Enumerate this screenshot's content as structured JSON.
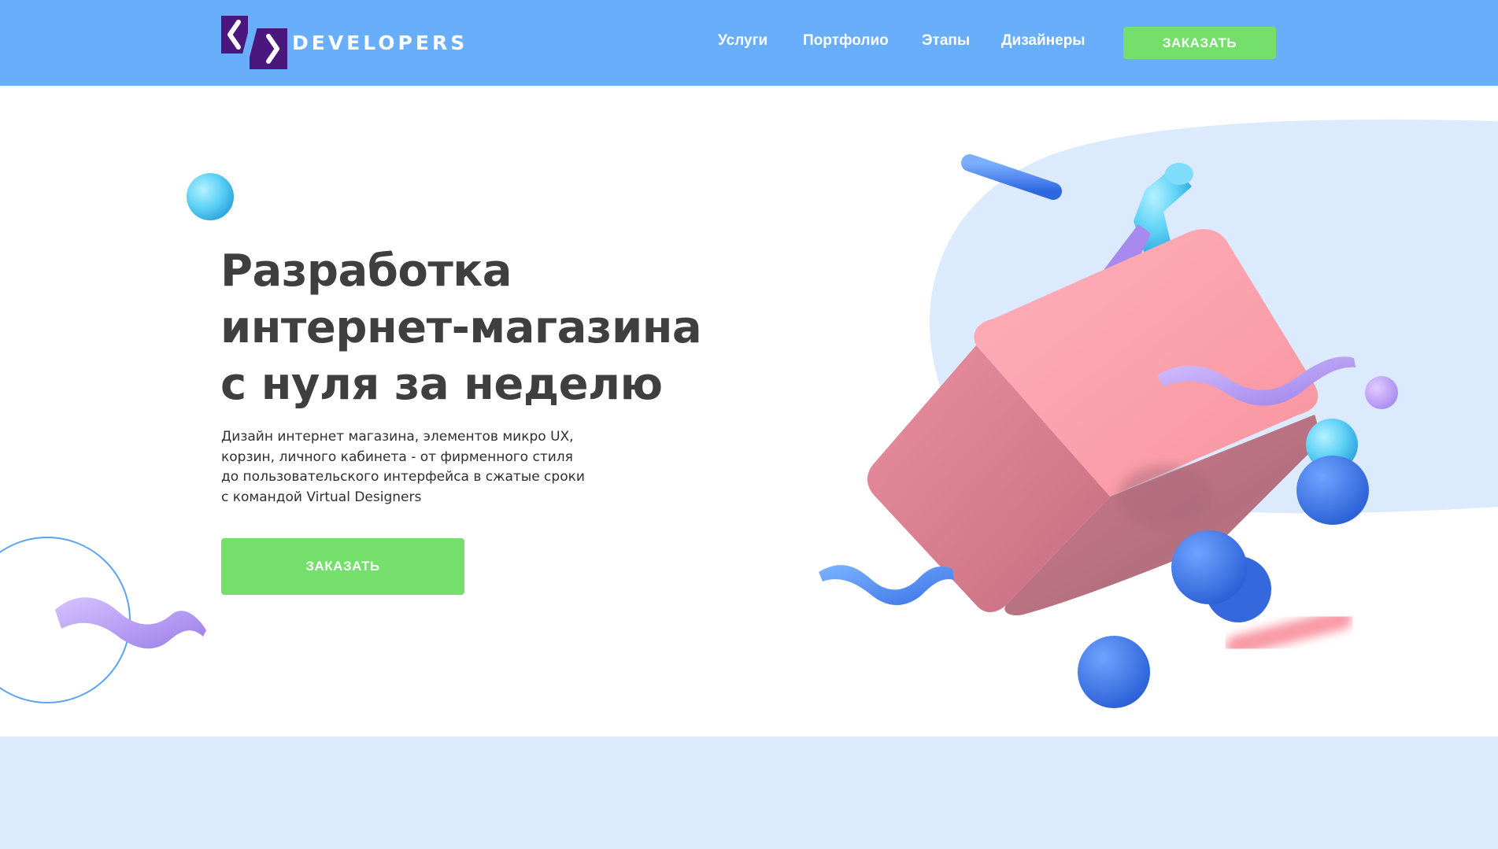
{
  "colors": {
    "header_bg": "#68aefa",
    "accent_green": "#74df6b",
    "logo_purple": "#4a177e",
    "heading_text": "#3f3f3f",
    "band_bg": "#dbeafd"
  },
  "header": {
    "logo_text": "DEVELOPERS",
    "logo_icon": "code-brackets-icon",
    "nav": [
      {
        "label": "Услуги"
      },
      {
        "label": "Портфолио"
      },
      {
        "label": "Этапы"
      },
      {
        "label": "Дизайнеры"
      }
    ],
    "cta_label": "ЗАКАЗАТЬ"
  },
  "hero": {
    "title_lines": [
      "Разработка",
      "интернет-магазина",
      "с нуля за неделю"
    ],
    "description_lines": [
      "Дизайн интернет магазина, элементов микро UX,",
      "корзин, личного кабинета - от фирменного стиля",
      "до пользовательского интерфейса в сжатые сроки",
      "с командой Virtual Designers"
    ],
    "cta_label": "ЗАКАЗАТЬ",
    "illustration": "3d-shopping-basket-illustration"
  }
}
